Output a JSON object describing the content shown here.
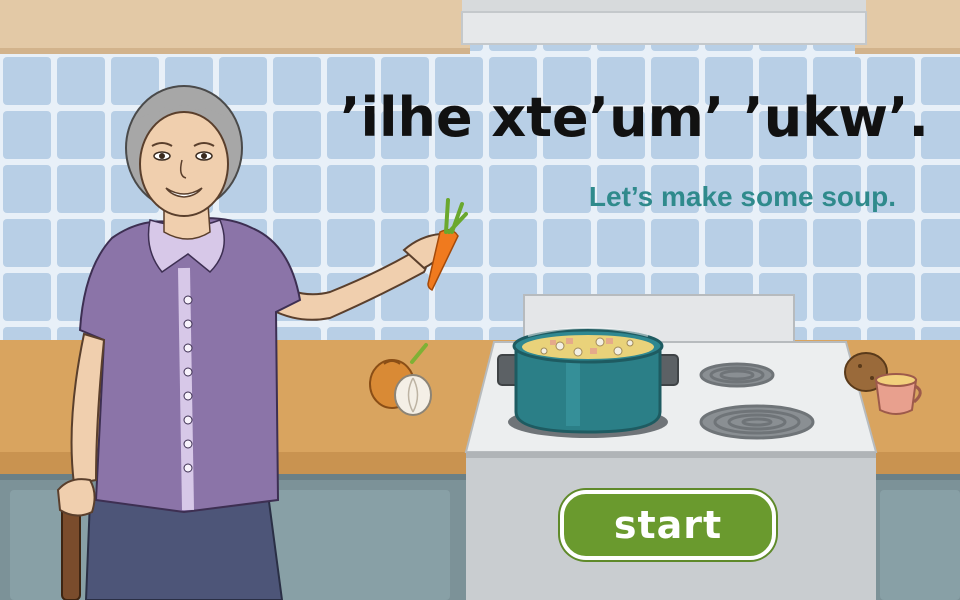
{
  "lesson": {
    "title": "’ilhe xte’um’ ’ukw’.",
    "subtitle": "Let’s make some soup."
  },
  "controls": {
    "start_label": "start"
  },
  "colors": {
    "wall_tile": "#b8cfe6",
    "grout": "#e8f0f8",
    "counter": "#d9a45f",
    "cabinet": "#7c9298",
    "stove": "#c9cdd0",
    "pot": "#2b7f87",
    "title": "#111111",
    "subtitle": "#2f8a8c",
    "start_button": "#6a9a2e",
    "cardigan": "#8b74a8"
  },
  "icons": [
    "carrot-icon",
    "onion-icon",
    "potato-icon",
    "cup-icon",
    "soup-pot-icon"
  ]
}
